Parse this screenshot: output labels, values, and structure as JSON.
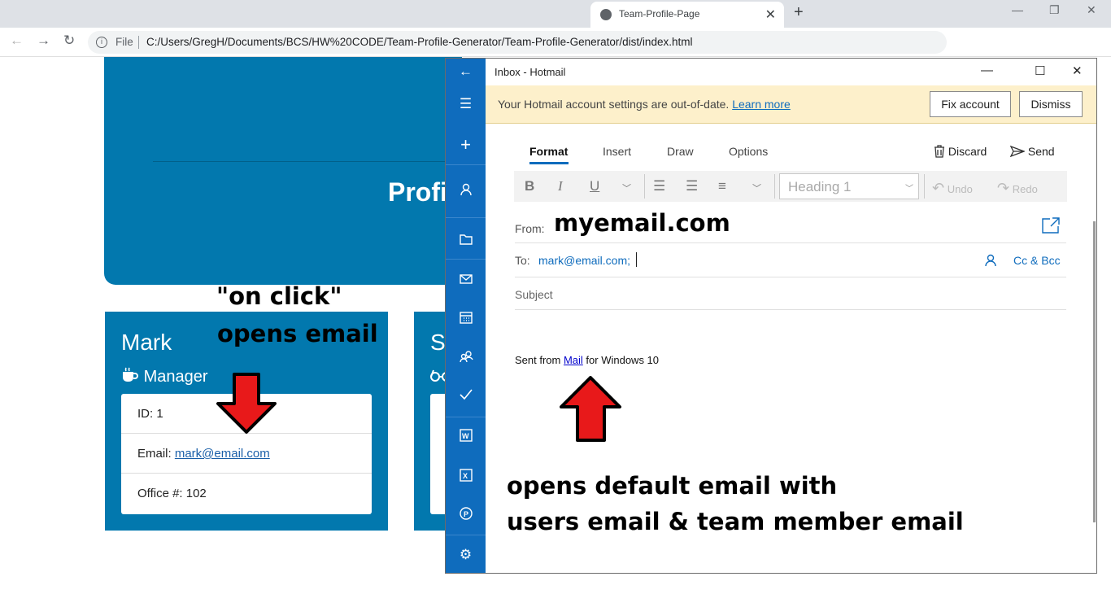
{
  "browser": {
    "tab_title": "Team-Profile-Page",
    "tab_close": "✕",
    "new_tab": "+",
    "minimize": "—",
    "restore": "❐",
    "close": "✕",
    "back": "←",
    "forward": "→",
    "reload": "↻",
    "info": "i",
    "file_label": "File",
    "url": "C:/Users/GregH/Documents/BCS/HW%20CODE/Team-Profile-Generator/Team-Profile-Generator/dist/index.html"
  },
  "page": {
    "banner_text": "Profil",
    "card1": {
      "name": "Mark",
      "role": "Manager",
      "id": "ID: 1",
      "email_label": "Email: ",
      "email": "mark@email.com",
      "office": "Office #: 102"
    },
    "card2": {
      "name": "Su"
    }
  },
  "mail": {
    "window_title": "Inbox - Hotmail",
    "notice_text": "Your Hotmail account settings are out-of-date. ",
    "notice_link": "Learn more",
    "fix_account": "Fix account",
    "dismiss": "Dismiss",
    "tabs": [
      "Format",
      "Insert",
      "Draw",
      "Options"
    ],
    "discard": "Discard",
    "send": "Send",
    "bold": "B",
    "italic": "I",
    "underline": "U",
    "heading_style": "Heading 1",
    "undo": "Undo",
    "redo": "Redo",
    "from_label": "From:",
    "from_value": "myemail.com",
    "to_label": "To:",
    "to_value": "mark@email.com;",
    "cc_bcc": "Cc & Bcc",
    "subject_placeholder": "Subject",
    "signature_prefix": "Sent from ",
    "signature_link": "Mail",
    "signature_suffix": " for Windows 10"
  },
  "annotations": {
    "on_click": "\"on click\"",
    "opens_email": "opens email",
    "caption_line1": "opens default email with",
    "caption_line2": "users email & team member email"
  },
  "colors": {
    "card_blue": "#0278ae",
    "mail_rail": "#0f6cbd",
    "arrow_red": "#e8191a"
  }
}
